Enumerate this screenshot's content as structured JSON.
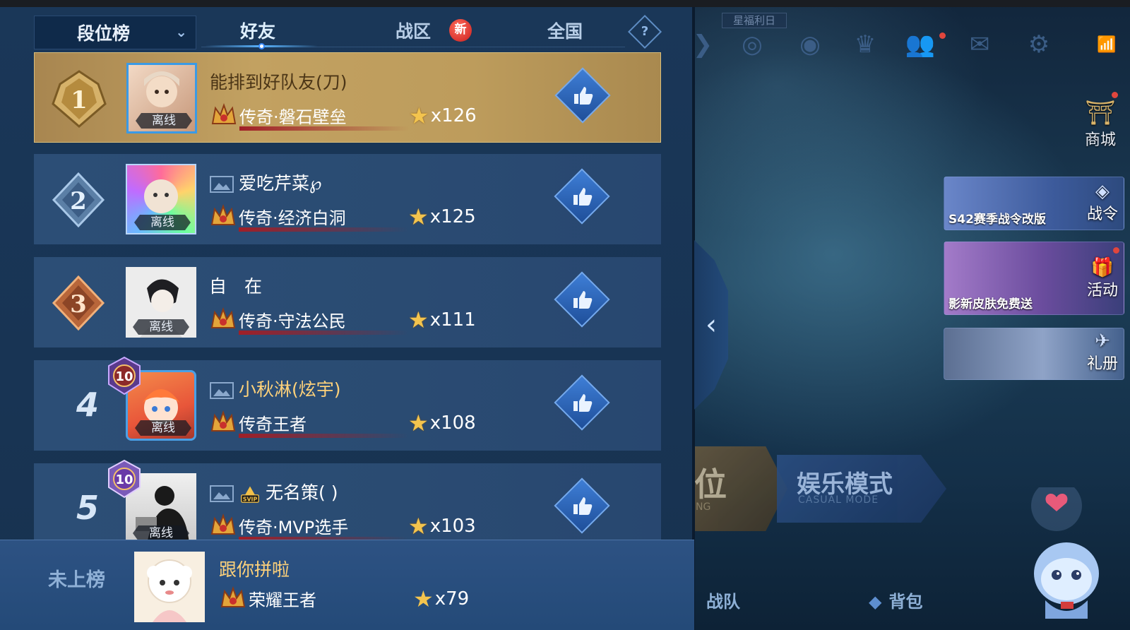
{
  "header": {
    "rank_select_label": "段位榜",
    "tabs": [
      {
        "label": "好友",
        "active": true
      },
      {
        "label": "战区",
        "badge": "新"
      },
      {
        "label": "全国"
      }
    ],
    "help_symbol": "?"
  },
  "leaderboard": [
    {
      "rank": "1",
      "name": "能排到好队友(刀)",
      "tier": "传奇·磐石壁垒",
      "stars": "x126",
      "status": "离线",
      "highlight": true
    },
    {
      "rank": "2",
      "name": "爱吃芹菜℘",
      "tier": "传奇·经济白洞",
      "stars": "x125",
      "status": "离线"
    },
    {
      "rank": "3",
      "name": "自　在",
      "tier": "传奇·守法公民",
      "stars": "x111",
      "status": "离线"
    },
    {
      "rank": "4",
      "name": "小秋淋(炫宇)",
      "tier": "传奇王者",
      "stars": "x108",
      "status": "离线",
      "level": "10"
    },
    {
      "rank": "5",
      "name": "无名策( )",
      "tier": "传奇·MVP选手",
      "stars": "x103",
      "status": "离线",
      "level": "10",
      "vip": "SVIP"
    }
  ],
  "self": {
    "label": "未上榜",
    "name": "跟你拼啦",
    "tier": "荣耀王者",
    "stars": "x79"
  },
  "lobby": {
    "event_title": "星福利日",
    "shop_label": "商城",
    "cards": [
      {
        "caption": "S42赛季战令改版",
        "tag": "战令"
      },
      {
        "caption": "影新皮肤免费送",
        "tag": "活动"
      },
      {
        "caption": "",
        "tag": "礼册"
      }
    ],
    "mode_left_char": "位",
    "mode_left_sub": "NG",
    "mode_right_title": "娱乐模式",
    "mode_right_sub": "CASUAL MODE",
    "bottom_items": [
      "战队",
      "背包"
    ]
  },
  "colors": {
    "gold_row": "#c2a161",
    "row_bg": "#2a4b72",
    "accent_blue": "#5ab4ff",
    "star": "#f3c44e",
    "name_gold": "#ffd27a"
  }
}
